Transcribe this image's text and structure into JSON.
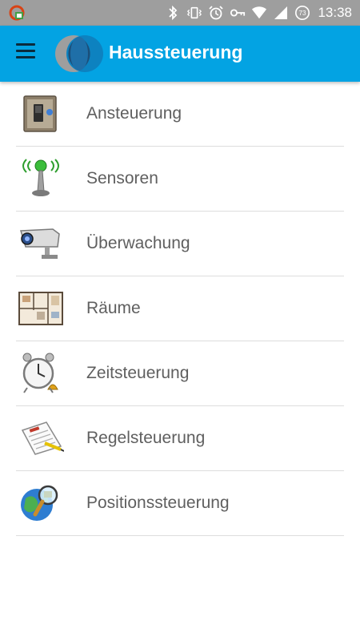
{
  "status_bar": {
    "time": "13:38",
    "battery_level": "73",
    "icons": [
      "app-notification-icon",
      "bluetooth-icon",
      "vibrate-icon",
      "alarm-icon",
      "vpn-key-icon",
      "wifi-icon",
      "cell-signal-icon",
      "battery-icon"
    ]
  },
  "app_bar": {
    "title": "Haussteuerung",
    "menu_icon": "hamburger-menu-icon",
    "logo": "app-logo-icon",
    "color": "#03a3e3"
  },
  "menu": {
    "items": [
      {
        "label": "Ansteuerung",
        "icon": "switch-panel-icon"
      },
      {
        "label": "Sensoren",
        "icon": "antenna-sensor-icon"
      },
      {
        "label": "Überwachung",
        "icon": "security-camera-icon"
      },
      {
        "label": "Räume",
        "icon": "floor-plan-icon"
      },
      {
        "label": "Zeitsteuerung",
        "icon": "alarm-clock-icon"
      },
      {
        "label": "Regelsteuerung",
        "icon": "rules-document-icon"
      },
      {
        "label": "Positionssteuerung",
        "icon": "globe-magnifier-icon"
      }
    ]
  }
}
